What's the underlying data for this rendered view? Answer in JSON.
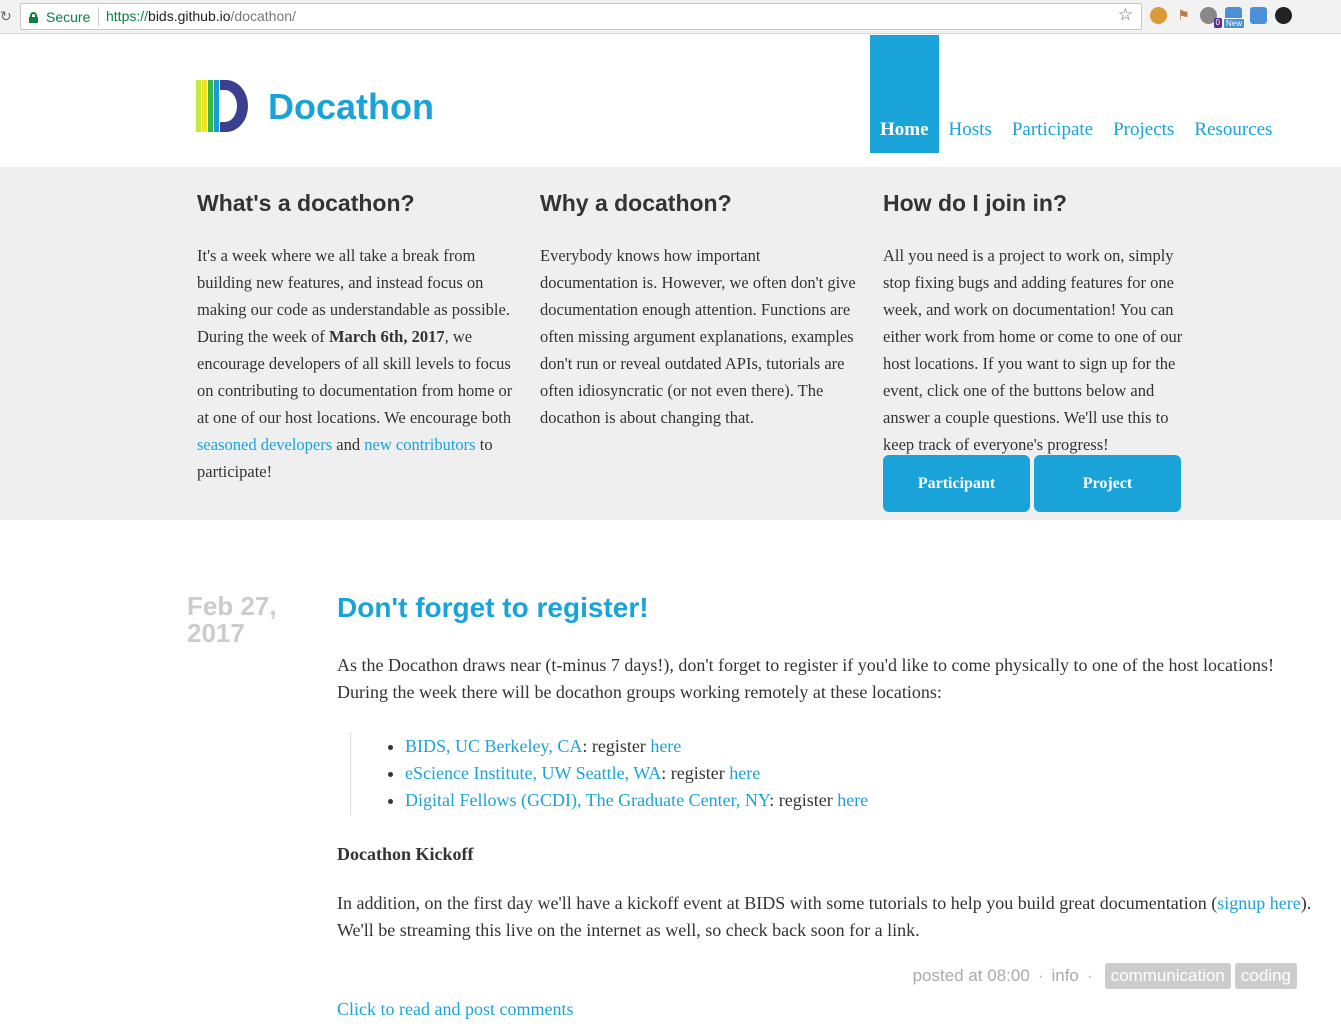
{
  "browser": {
    "secure_label": "Secure",
    "url_scheme": "https://",
    "url_host": "bids.github.io",
    "url_path": "/docathon/",
    "ext_ghost_count": "0",
    "ext_news_badge": "New"
  },
  "site": {
    "brand": "Docathon",
    "nav": [
      "Home",
      "Hosts",
      "Participate",
      "Projects",
      "Resources"
    ]
  },
  "intro": {
    "col1": {
      "title": "What's a docathon?",
      "text_a": "It's a week where we all take a break from building new features, and instead focus on making our code as understandable as possible. During the week of ",
      "text_bold": "March 6th, 2017",
      "text_b": ", we encourage developers of all skill levels to focus on contributing to documentation from home or at one of our host locations. We encourage both ",
      "link1": "seasoned developers",
      "text_c": " and ",
      "link2": "new contributors",
      "text_d": " to participate!"
    },
    "col2": {
      "title": "Why a docathon?",
      "text": "Everybody knows how important documentation is. However, we often don't give documentation enough attention. Functions are often missing argument explanations, examples don't run or reveal outdated APIs, tutorials are often idiosyncratic (or not even there). The docathon is about changing that."
    },
    "col3": {
      "title": "How do I join in?",
      "text": "All you need is a project to work on, simply stop fixing bugs and adding features for one week, and work on documentation! You can either work from home or come to one of our host locations. If you want to sign up for the event, click one of the buttons below and answer a couple questions. We'll use this to keep track of everyone's progress!"
    },
    "buttons": [
      "Participant",
      "Project"
    ]
  },
  "post": {
    "date": "Feb 27, 2017",
    "title": "Don't forget to register!",
    "p1": "As the Docathon draws near (t-minus 7 days!), don't forget to register if you'd like to come physically to one of the host locations! During the week there will be docathon groups working remotely at these locations:",
    "locations": [
      {
        "name": "BIDS, UC Berkeley, CA",
        "sep": ": register ",
        "link": "here"
      },
      {
        "name": "eScience Institute, UW Seattle, WA",
        "sep": ": register ",
        "link": "here"
      },
      {
        "name": "Digital Fellows (GCDI), The Graduate Center, NY",
        "sep": ": register ",
        "link": "here"
      }
    ],
    "kickoff_title": "Docathon Kickoff",
    "p2_a": "In addition, on the first day we'll have a kickoff event at BIDS with some tutorials to help you build great documentation (",
    "p2_link": "signup here",
    "p2_b": "). We'll be streaming this live on the internet as well, so check back soon for a link.",
    "posted": "posted at 08:00",
    "category": "info",
    "tags": [
      "communication",
      "coding"
    ],
    "comments": "Click to read and post comments"
  },
  "colors": {
    "accent": "#1aa3d9",
    "band": "#efefef",
    "date": "#cccccc"
  }
}
